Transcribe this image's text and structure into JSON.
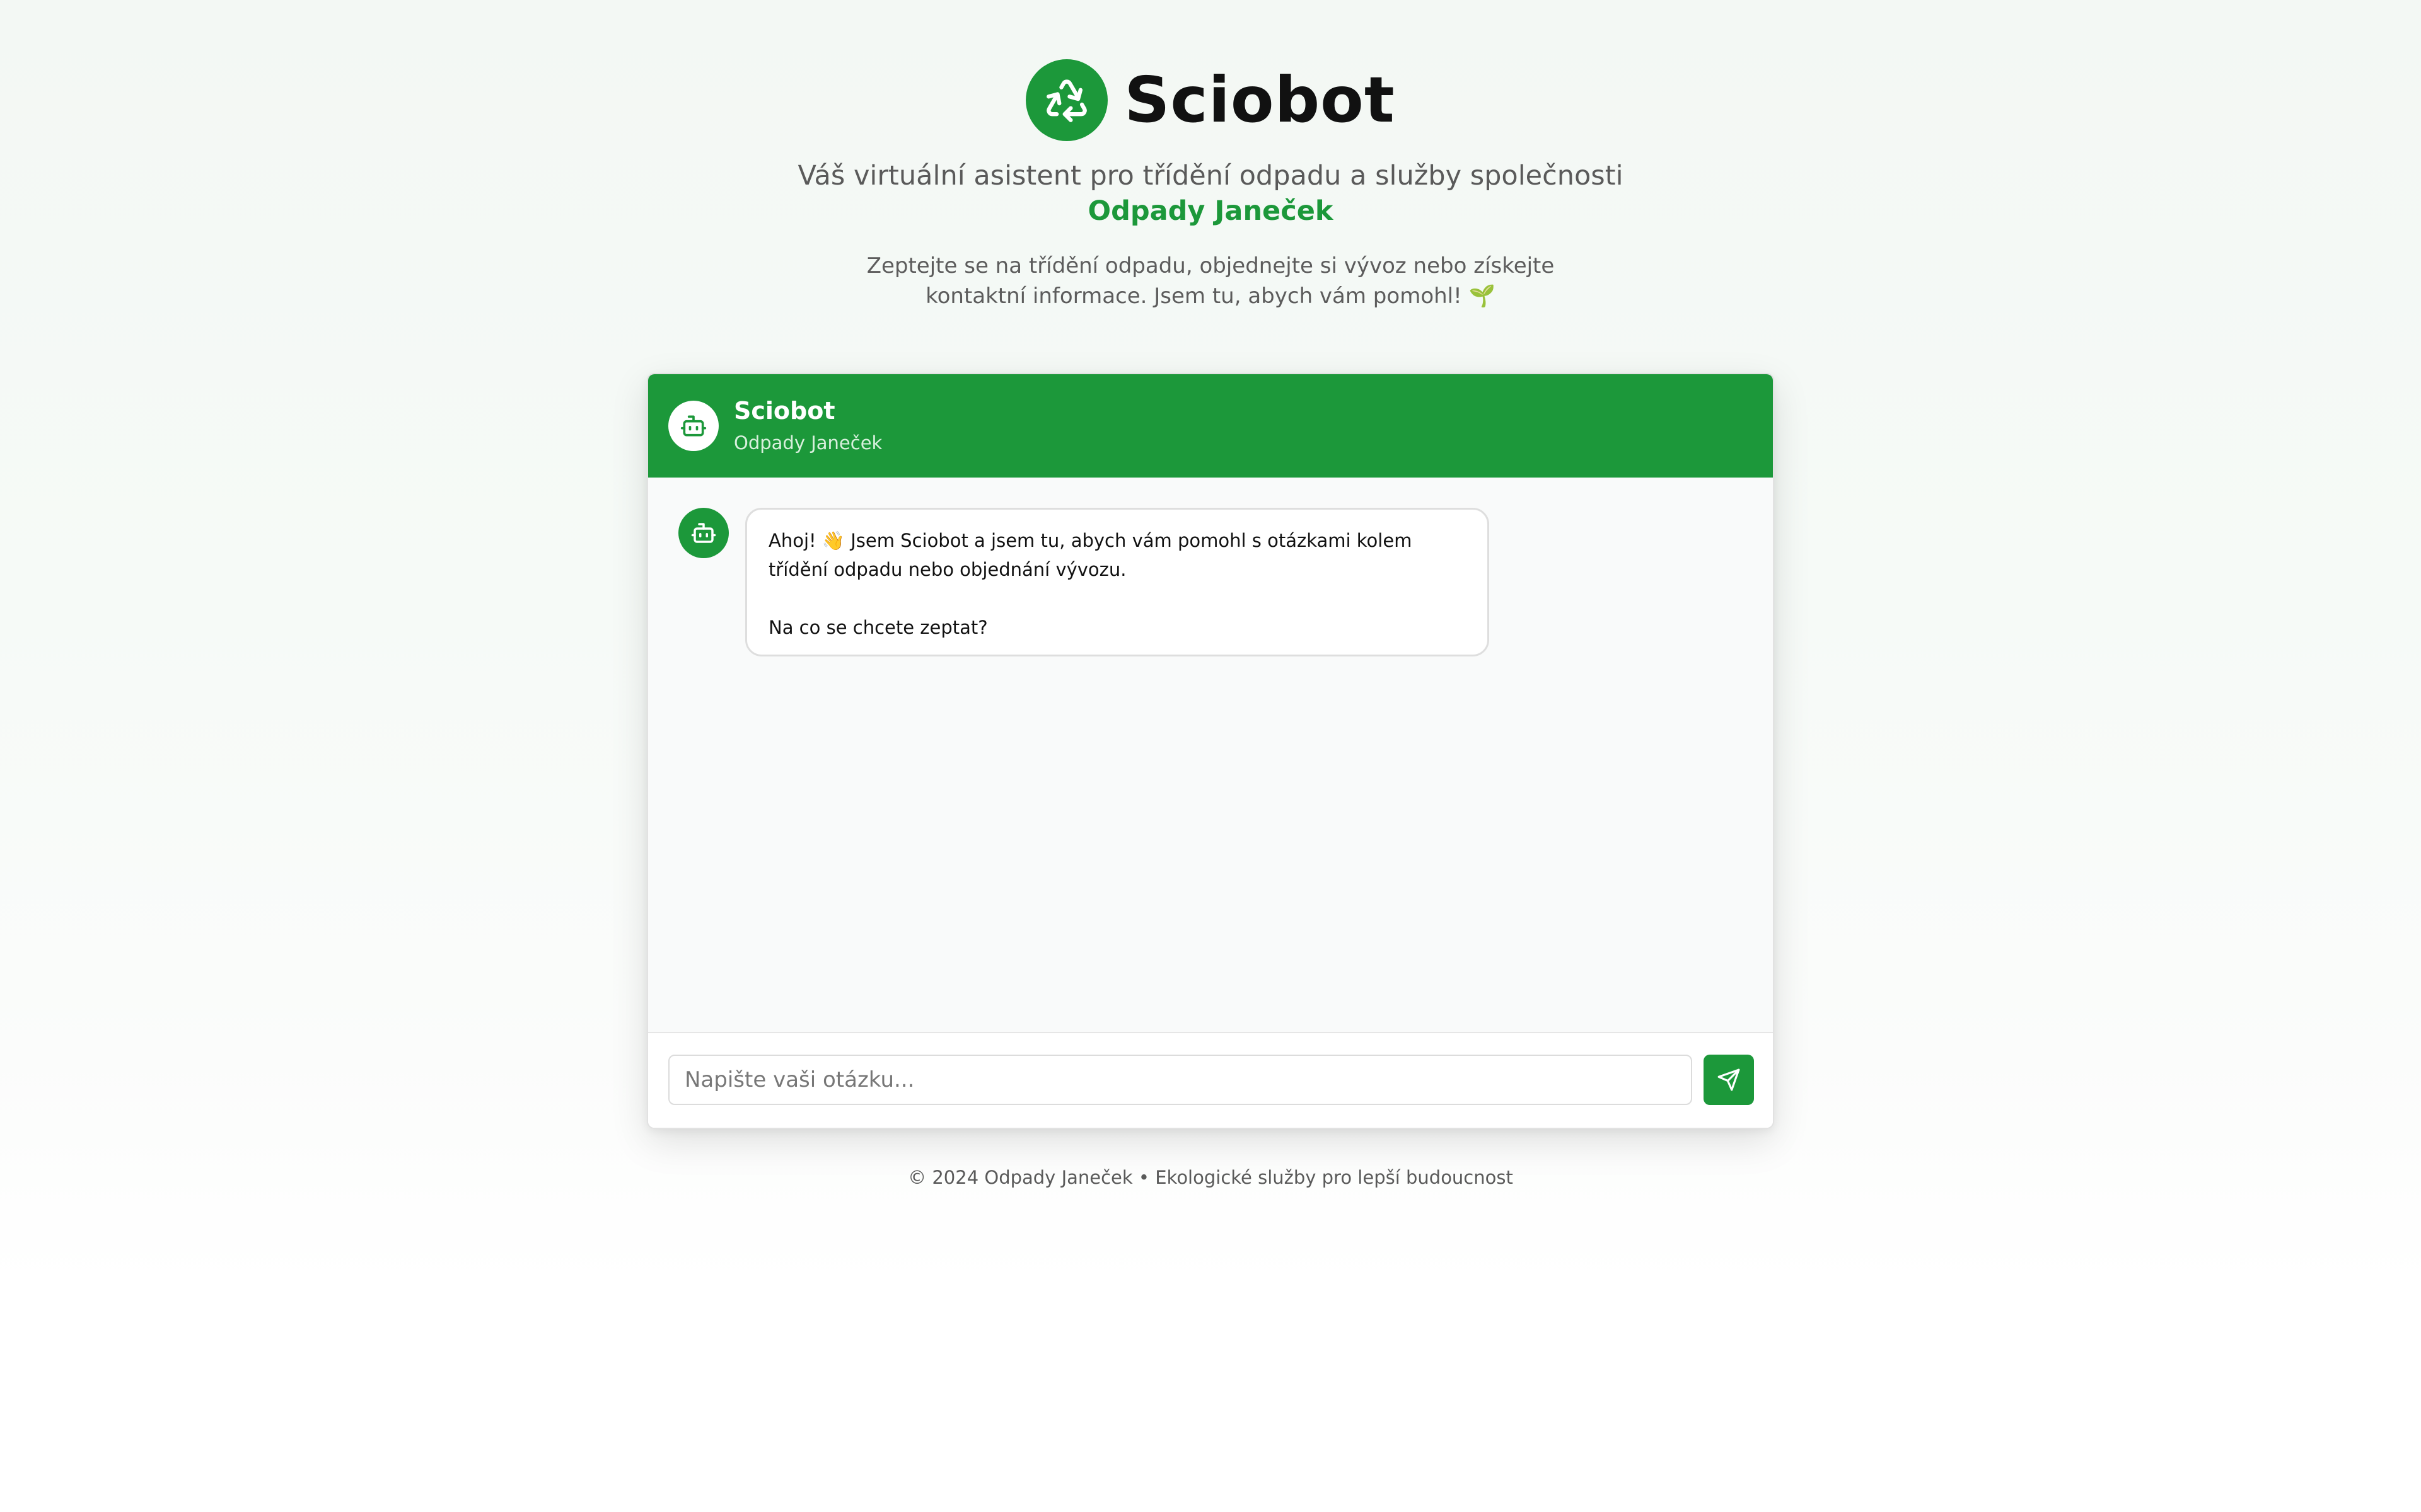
{
  "brand": {
    "title": "Sciobot",
    "logo_icon": "recycle-icon"
  },
  "hero": {
    "subtitle": "Váš virtuální asistent pro třídění odpadu a služby společnosti",
    "company": "Odpady Janeček",
    "intro": "Zeptejte se na třídění odpadu, objednejte si vývoz nebo získejte kontaktní informace. Jsem tu, abych vám pomohl! 🌱"
  },
  "chat": {
    "header": {
      "name": "Sciobot",
      "subtitle": "Odpady Janeček",
      "avatar_icon": "robot-icon"
    },
    "messages": [
      {
        "sender": "bot",
        "avatar_icon": "robot-icon",
        "paragraphs": [
          "Ahoj! 👋 Jsem Sciobot a jsem tu, abych vám pomohl s otázkami kolem třídění odpadu nebo objednání vývozu.",
          "Na co se chcete zeptat?"
        ]
      }
    ],
    "input": {
      "placeholder": "Napište vaši otázku...",
      "value": ""
    },
    "send_icon": "send-icon"
  },
  "footer": {
    "copyright": "© 2024 Odpady Janeček • Ekologické služby pro lepší budoucnost"
  },
  "colors": {
    "accent": "#1c983a"
  }
}
